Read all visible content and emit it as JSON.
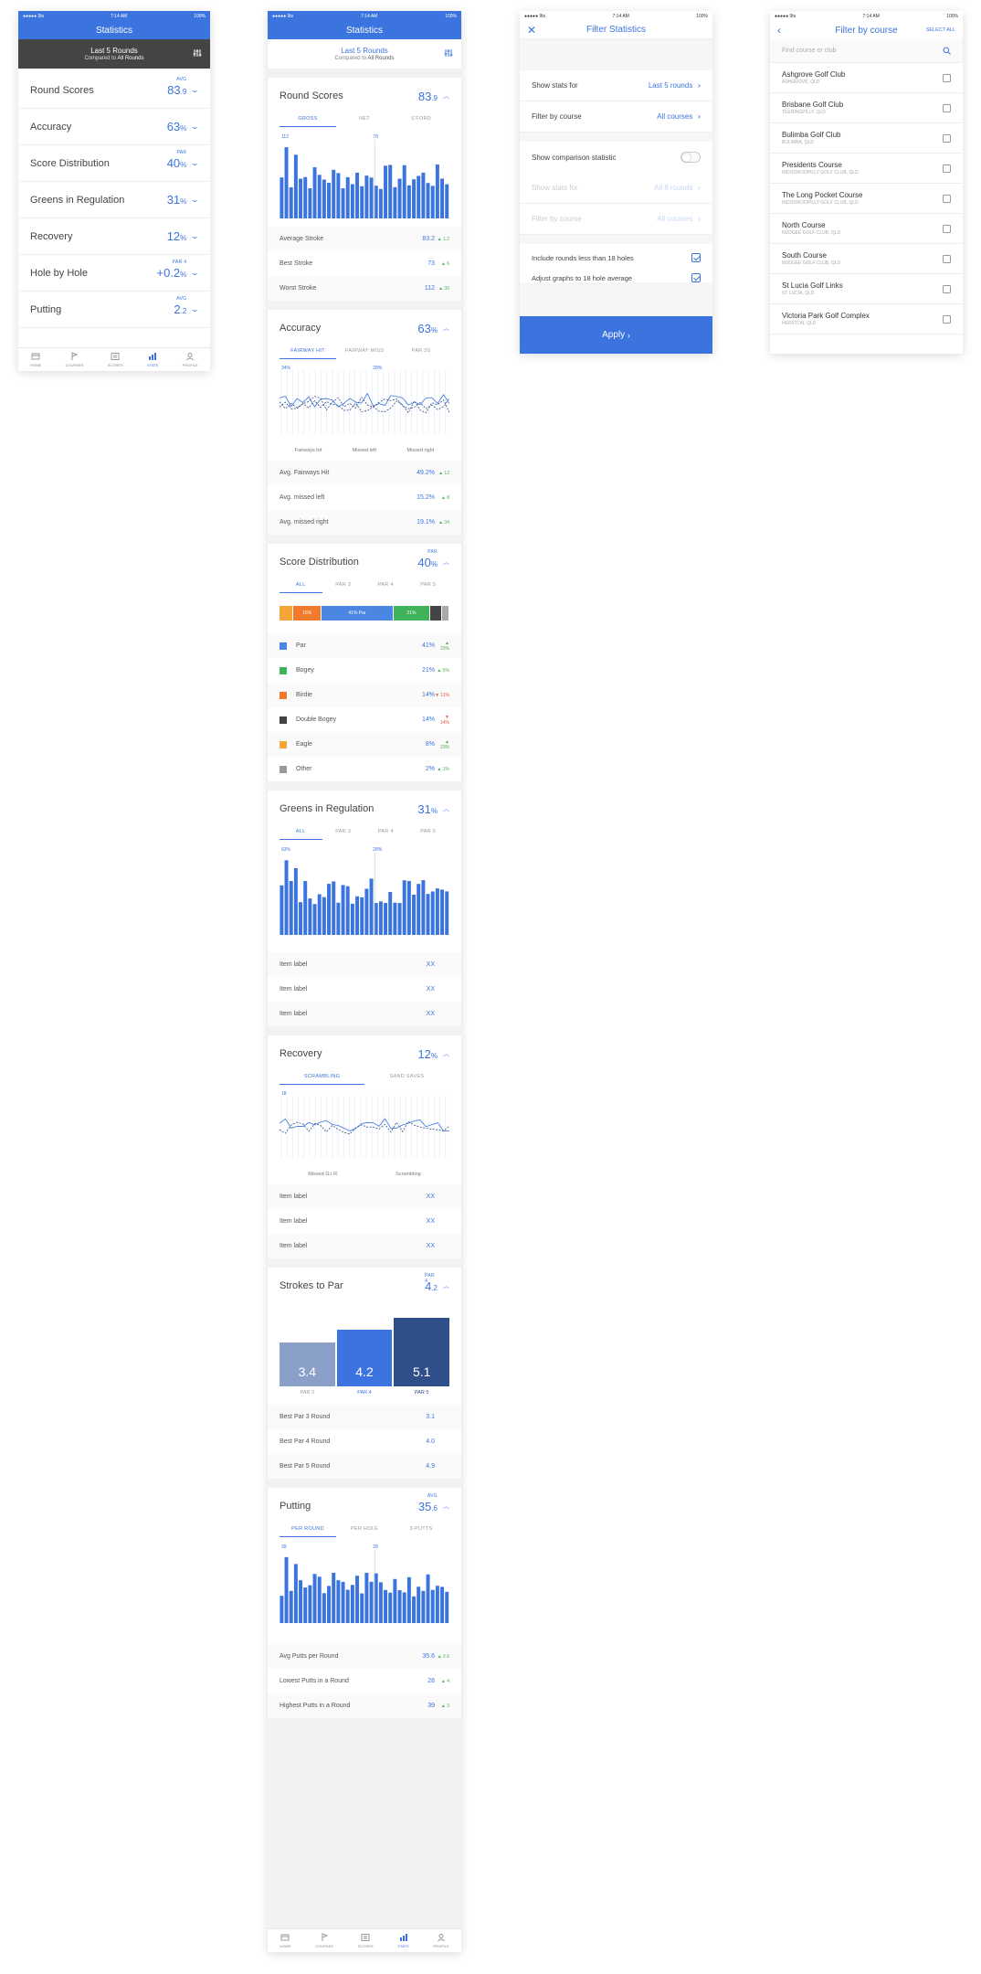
{
  "status": {
    "carrier": "●●●●● 9ts",
    "time": "7:14 AM",
    "battery": "100%"
  },
  "s1": {
    "title": "Statistics",
    "last": "Last 5 Rounds",
    "compared": "Compared to",
    "compared_b": "All Rounds",
    "rows": [
      {
        "label": "Round Scores",
        "tag": "AVG",
        "value": "83",
        "unit": ".9"
      },
      {
        "label": "Accuracy",
        "tag": "",
        "value": "63",
        "unit": "%"
      },
      {
        "label": "Score Distribution",
        "tag": "PAR",
        "value": "40",
        "unit": "%"
      },
      {
        "label": "Greens in Regulation",
        "tag": "",
        "value": "31",
        "unit": "%"
      },
      {
        "label": "Recovery",
        "tag": "",
        "value": "12",
        "unit": "%"
      },
      {
        "label": "Hole by Hole",
        "tag": "PAR 4",
        "value": "+0.2",
        "unit": "%"
      },
      {
        "label": "Putting",
        "tag": "AVG",
        "value": "2",
        "unit": ".2"
      }
    ]
  },
  "tabs": [
    "HOME",
    "COURSES",
    "SCORES",
    "STATS",
    "PROFILE"
  ],
  "s2": {
    "round": {
      "title": "Round Scores",
      "value": "83",
      "unit": ".9",
      "tabs": [
        "GROSS",
        "NET",
        "S'FORD"
      ],
      "peak1": "112",
      "peak2": "78",
      "stats": [
        {
          "l": "Average Stroke",
          "v": "83.2",
          "d": "▲ 1.2"
        },
        {
          "l": "Best Stroke",
          "v": "73",
          "d": "▲ 6"
        },
        {
          "l": "Worst Stroke",
          "v": "112",
          "d": "▲ 30"
        }
      ]
    },
    "acc": {
      "title": "Accuracy",
      "value": "63",
      "unit": "%",
      "tabs": [
        "FAIRWAY HIT",
        "FAIRWAY MISS",
        "PAR 3S"
      ],
      "legend": [
        "Fairways hit",
        "Missed left",
        "Missed right"
      ],
      "p1": "34%",
      "p2": "28%",
      "stats": [
        {
          "l": "Avg. Fairways Hit",
          "v": "49.2%",
          "d": "▲ 12"
        },
        {
          "l": "Avg. missed left",
          "v": "15.2%",
          "d": "▲ 8"
        },
        {
          "l": "Avg. missed right",
          "v": "19.1%",
          "d": "▲ 34"
        }
      ]
    },
    "dist": {
      "title": "Score Distribution",
      "tag": "PAR",
      "value": "40",
      "unit": "%",
      "tabs": [
        "ALL",
        "PAR 3",
        "PAR 4",
        "PAR 5"
      ],
      "bar": [
        {
          "t": "",
          "c": "#f5a43a",
          "w": 6
        },
        {
          "t": "16%",
          "c": "#f07a2a",
          "w": 13
        },
        {
          "t": "41% Par",
          "c": "#4a86e2",
          "w": 33
        },
        {
          "t": "21%",
          "c": "#3fb25a",
          "w": 17
        },
        {
          "t": "",
          "c": "#444",
          "w": 5
        },
        {
          "t": "",
          "c": "#aaa",
          "w": 3
        }
      ],
      "stats": [
        {
          "l": "Par",
          "v": "41%",
          "d": "▲ 23%",
          "c": "#4a86e2"
        },
        {
          "l": "Bogey",
          "v": "21%",
          "d": "▲ 5%",
          "c": "#3fb25a"
        },
        {
          "l": "Birdie",
          "v": "14%",
          "d": "▼ 11%",
          "c": "#f07a2a",
          "r": 1
        },
        {
          "l": "Double Bogey",
          "v": "14%",
          "d": "▼ 14%",
          "c": "#444",
          "r": 1
        },
        {
          "l": "Eagle",
          "v": "8%",
          "d": "▲ 23%",
          "c": "#f5a43a"
        },
        {
          "l": "Other",
          "v": "2%",
          "d": "▲ 1%",
          "c": "#999"
        }
      ]
    },
    "gir": {
      "title": "Greens in Regulation",
      "value": "31",
      "unit": "%",
      "tabs": [
        "ALL",
        "PAR 3",
        "PAR 4",
        "PAR 5"
      ],
      "p1": "63%",
      "p2": "28%",
      "stats": [
        {
          "l": "Item label",
          "v": "XX"
        },
        {
          "l": "Item label",
          "v": "XX"
        },
        {
          "l": "Item label",
          "v": "XX"
        }
      ]
    },
    "rec": {
      "title": "Recovery",
      "value": "12",
      "unit": "%",
      "tabs": [
        "SCRAMBLING",
        "SAND SAVES"
      ],
      "legend": [
        "Missed G.I.R.",
        "Scrambling"
      ],
      "p1": "18",
      "stats": [
        {
          "l": "Item label",
          "v": "XX"
        },
        {
          "l": "Item label",
          "v": "XX"
        },
        {
          "l": "Item label",
          "v": "XX"
        }
      ]
    },
    "stp": {
      "title": "Strokes to Par",
      "tag": "PAR 4",
      "value": "4",
      "unit": ".2",
      "bars": [
        {
          "v": "3.4",
          "l": "PAR 3",
          "c": "#8aa0c8"
        },
        {
          "v": "4.2",
          "l": "PAR 4",
          "c": "#3b74de"
        },
        {
          "v": "5.1",
          "l": "PAR 5",
          "c": "#2f4f8a"
        }
      ],
      "stats": [
        {
          "l": "Best Par 3 Round",
          "v": "3.1"
        },
        {
          "l": "Best Par 4 Round",
          "v": "4.0"
        },
        {
          "l": "Best Par 5 Round",
          "v": "4.9"
        }
      ]
    },
    "putt": {
      "title": "Putting",
      "tag": "AVG",
      "value": "35",
      "unit": ".6",
      "tabs": [
        "PER ROUND",
        "PER HOLE",
        "3-PUTTS"
      ],
      "p1": "39",
      "p2": "28",
      "stats": [
        {
          "l": "Avg Putts per Round",
          "v": "35.6",
          "d": "▲ 2.6"
        },
        {
          "l": "Lowest Putts in a Round",
          "v": "28",
          "d": "▲ 4"
        },
        {
          "l": "Highest Putts in a Round",
          "v": "39",
          "d": "▲ 3"
        }
      ]
    }
  },
  "s3": {
    "title": "Filter Statistics",
    "rows": [
      {
        "l": "Show stats for",
        "v": "Last 5 rounds"
      },
      {
        "l": "Filter by course",
        "v": "All courses"
      }
    ],
    "toggle": "Show comparison statistic",
    "dim": [
      {
        "l": "Show stats for",
        "v": "All 8 rounds"
      },
      {
        "l": "Filter by course",
        "v": "All courses"
      }
    ],
    "checks": [
      "Include rounds less than 18 holes",
      "Adjust graphs to 18 hole average"
    ],
    "apply": "Apply"
  },
  "s4": {
    "title": "Filter by course",
    "select_all": "SELECT ALL",
    "search": "Find course or club",
    "courses": [
      {
        "n": "Ashgrove Golf Club",
        "l": "ASHGROVE, QLD"
      },
      {
        "n": "Brisbane Golf Club",
        "l": "TEERINGPILLY, QLD"
      },
      {
        "n": "Bulimba Golf Club",
        "l": "BULIMBA, QLD"
      },
      {
        "n": "Presidents Course",
        "l": "INDOOROOPILLY GOLF CLUB, QLD"
      },
      {
        "n": "The Long Pocket Course",
        "l": "INDOOROOPILLY GOLF CLUB, QLD"
      },
      {
        "n": "North Course",
        "l": "NUDGEE GOLF CLUB, QLD"
      },
      {
        "n": "South Course",
        "l": "NUDGEE GOLF CLUB, QLD"
      },
      {
        "n": "St Lucia Golf Links",
        "l": "ST LUCIA, QLD"
      },
      {
        "n": "Victoria Park Golf Complex",
        "l": "HERSTON, QLD"
      }
    ]
  },
  "colors": {
    "accent": "#3b74de",
    "dark_header": "#444444"
  }
}
